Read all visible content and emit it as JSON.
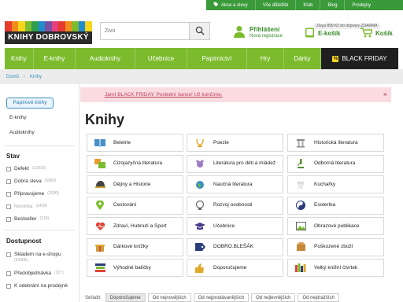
{
  "topbar": {
    "links": [
      "Akce a slevy",
      "Vše důležité",
      "Klub",
      "Blog",
      "Prodejny"
    ]
  },
  "header": {
    "logo_text": "KNIHY DOBROVSKÝ",
    "logo_colors": [
      "#e63b2e",
      "#f28c1c",
      "#f7d51b",
      "#7cbb2d",
      "#2f9e4f",
      "#1f8ccf",
      "#7b4fa0",
      "#e6407e",
      "#e63b2e",
      "#f28c1c",
      "#7cbb2d",
      "#1f8ccf",
      "#f7d51b"
    ],
    "search_placeholder": "Živo",
    "login_title": "Přihlášení",
    "login_sub": "Nová registrace",
    "ekosik": "E-košík",
    "kosik": "Košík",
    "free_shipping": "Zisya 899 Kč do dopravy ZDARMA"
  },
  "nav": {
    "items": [
      "Knihy",
      "E-knihy",
      "Audioknihy",
      "Učebnice",
      "Papírnictví",
      "Hry",
      "Dárky"
    ],
    "black_friday": "BLACK FRIDAY",
    "black_friday_badge": "%"
  },
  "breadcrumb": [
    "Domů",
    "Knihy"
  ],
  "sidebar": {
    "format_active": "Papírové knihy",
    "formats": [
      "E-knihy",
      "Audioknihy"
    ],
    "stav_title": "Stav",
    "stav": [
      {
        "label": "Defekt",
        "count": "(13916)",
        "dim": false
      },
      {
        "label": "Dobrá sleva",
        "count": "(5985)",
        "dim": false
      },
      {
        "label": "Připravujeme",
        "count": "(2030)",
        "dim": false
      },
      {
        "label": "Novinka",
        "count": "(1439)",
        "dim": true
      },
      {
        "label": "Bestseller",
        "count": "(218)",
        "dim": false
      }
    ],
    "dostupnost_title": "Dostupnost",
    "dostupnost": [
      {
        "label": "Skladem na e-shopu",
        "count": "(53468)"
      },
      {
        "label": "Předobjednávka",
        "count": "(327)"
      },
      {
        "label": "K odebrání na prodejně",
        "count": ""
      }
    ]
  },
  "alert": {
    "message": "Jarní BLACK FRIDAY. Poslední šance! Už končíme.",
    "close": "×"
  },
  "page_title": "Knihy",
  "categories": [
    {
      "label": "Beletrie",
      "icon": "book-icon"
    },
    {
      "label": "Poezie",
      "icon": "lyre-icon"
    },
    {
      "label": "Historická literatura",
      "icon": "column-icon"
    },
    {
      "label": "Cizojazyčná literatura",
      "icon": "translate-icon"
    },
    {
      "label": "Literatura pro děti a mládež",
      "icon": "teddy-icon"
    },
    {
      "label": "Odborná literatura",
      "icon": "microscope-icon"
    },
    {
      "label": "Dějiny a Historie",
      "icon": "helmet-icon"
    },
    {
      "label": "Naučná literatura",
      "icon": "globe-icon"
    },
    {
      "label": "Kuchařky",
      "icon": "chef-hat-icon"
    },
    {
      "label": "Cestování",
      "icon": "map-pin-icon"
    },
    {
      "label": "Rozvoj osobnosti",
      "icon": "head-icon"
    },
    {
      "label": "Esoterika",
      "icon": "yin-yang-icon"
    },
    {
      "label": "Zdraví, Hubnutí a Sport",
      "icon": "heart-pulse-icon"
    },
    {
      "label": "Učebnice",
      "icon": "graduation-cap-icon"
    },
    {
      "label": "Obrazové publikace",
      "icon": "picture-icon"
    },
    {
      "label": "Dárkové knížky",
      "icon": "gift-icon"
    },
    {
      "label": "DOBRO.BLEŠÁK",
      "icon": "label-icon"
    },
    {
      "label": "Poškozené zboží",
      "icon": "damaged-box-icon"
    },
    {
      "label": "Výhodné balíčky",
      "icon": "book-stack-icon"
    },
    {
      "label": "Doporučujeme",
      "icon": "thumbs-up-icon"
    },
    {
      "label": "Velký knižní čtvrtek",
      "icon": "books-icon"
    }
  ],
  "sort": {
    "label": "Seřadit:",
    "options": [
      "Doporučujeme",
      "Od nejnovějších",
      "Od nejprodávanějších",
      "Od nejlevnějších",
      "Od nejdražších"
    ]
  },
  "colors": {
    "brand_green": "#7cbb2d",
    "dark_green": "#3a9a3a",
    "link_blue": "#3a8fc4",
    "alert_bg": "#f9dbe0",
    "alert_text": "#c2405c"
  }
}
